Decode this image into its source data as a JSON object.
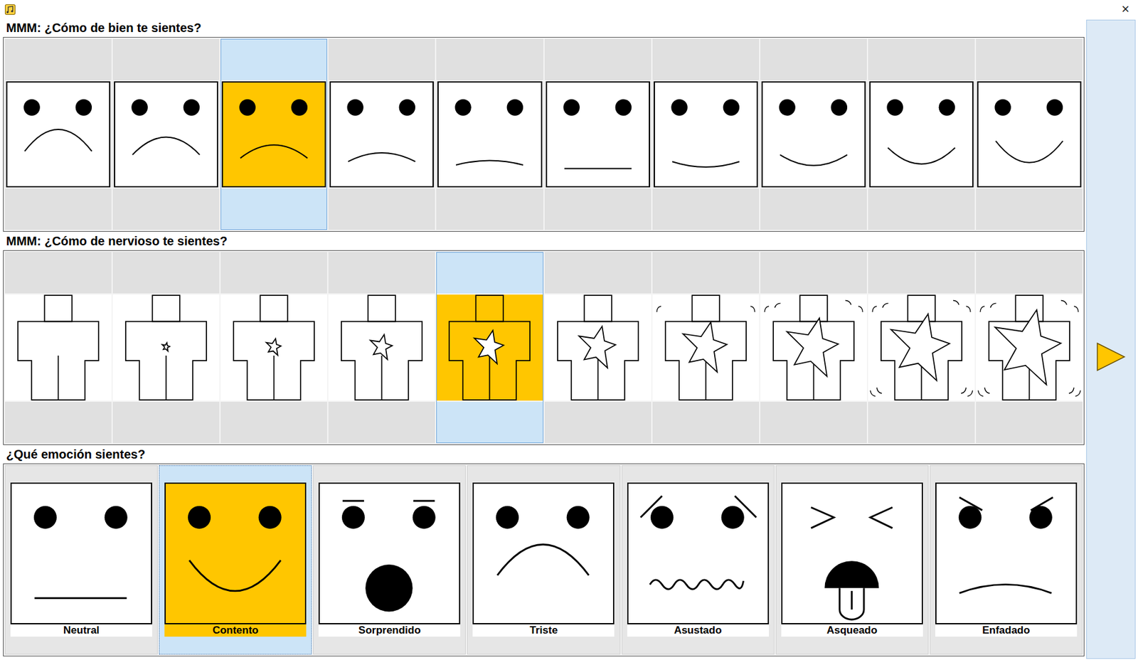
{
  "window": {
    "close": "×"
  },
  "scales": [
    {
      "title": "MMM: ¿Cómo de bien te sientes?",
      "kind": "valence",
      "items": [
        {
          "level": 0,
          "selected": false
        },
        {
          "level": 0.111,
          "selected": false
        },
        {
          "level": 0.222,
          "selected": true
        },
        {
          "level": 0.333,
          "selected": false
        },
        {
          "level": 0.444,
          "selected": false
        },
        {
          "level": 0.556,
          "selected": false
        },
        {
          "level": 0.667,
          "selected": false
        },
        {
          "level": 0.778,
          "selected": false
        },
        {
          "level": 0.889,
          "selected": false
        },
        {
          "level": 1,
          "selected": false
        }
      ]
    },
    {
      "title": "MMM: ¿Cómo de nervioso te sientes?",
      "kind": "arousal",
      "items": [
        {
          "level": 0,
          "selected": false
        },
        {
          "level": 0.111,
          "selected": false
        },
        {
          "level": 0.222,
          "selected": false
        },
        {
          "level": 0.333,
          "selected": false
        },
        {
          "level": 0.444,
          "selected": true
        },
        {
          "level": 0.556,
          "selected": false
        },
        {
          "level": 0.667,
          "selected": false
        },
        {
          "level": 0.778,
          "selected": false
        },
        {
          "level": 0.889,
          "selected": false
        },
        {
          "level": 1,
          "selected": false
        }
      ]
    }
  ],
  "emotions": {
    "title": "¿Qué emoción sientes?",
    "items": [
      {
        "label": "Neutral",
        "kind": "neutral",
        "selected": false
      },
      {
        "label": "Contento",
        "kind": "happy",
        "selected": true
      },
      {
        "label": "Sorprendido",
        "kind": "surprised",
        "selected": false
      },
      {
        "label": "Triste",
        "kind": "sad",
        "selected": false
      },
      {
        "label": "Asustado",
        "kind": "scared",
        "selected": false
      },
      {
        "label": "Asqueado",
        "kind": "disgusted",
        "selected": false
      },
      {
        "label": "Enfadado",
        "kind": "angry",
        "selected": false
      }
    ]
  }
}
